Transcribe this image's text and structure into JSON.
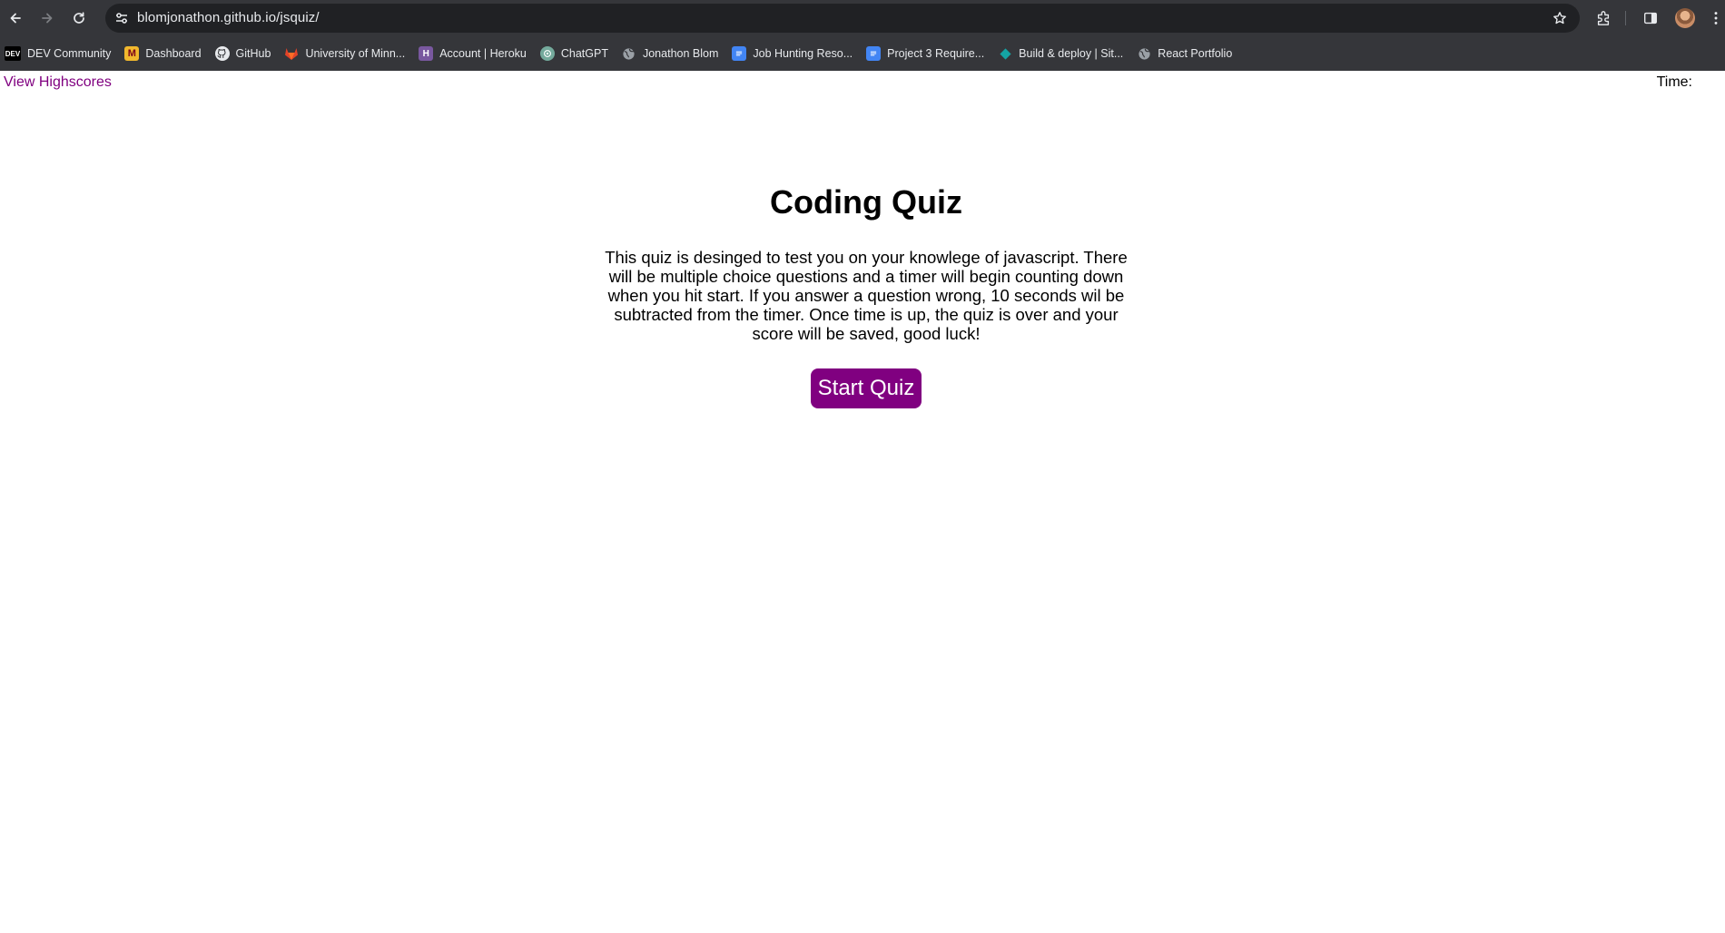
{
  "browser": {
    "url": "blomjonathon.github.io/jsquiz/",
    "bookmarks": [
      {
        "label": "DEV Community",
        "icon": "dev-icon",
        "icon_text": "DEV"
      },
      {
        "label": "Dashboard",
        "icon": "university-m-icon",
        "icon_text": "M"
      },
      {
        "label": "GitHub",
        "icon": "github-icon",
        "icon_text": ""
      },
      {
        "label": "University of Minn...",
        "icon": "gitlab-icon",
        "icon_text": ""
      },
      {
        "label": "Account | Heroku",
        "icon": "heroku-icon",
        "icon_text": "H"
      },
      {
        "label": "ChatGPT",
        "icon": "chatgpt-icon",
        "icon_text": ""
      },
      {
        "label": "Jonathon Blom",
        "icon": "globe-icon",
        "icon_text": ""
      },
      {
        "label": "Job Hunting Reso...",
        "icon": "google-docs-icon",
        "icon_text": ""
      },
      {
        "label": "Project 3 Require...",
        "icon": "google-docs-icon",
        "icon_text": ""
      },
      {
        "label": "Build & deploy | Sit...",
        "icon": "netlify-icon",
        "icon_text": ""
      },
      {
        "label": "React Portfolio",
        "icon": "globe-icon",
        "icon_text": ""
      }
    ],
    "colors": {
      "chrome": "#35363a",
      "omnibox": "#202124",
      "text": "#e8eaed"
    }
  },
  "page": {
    "highscores_link": "View Highscores",
    "timer_label": "Time:",
    "title": "Coding Quiz",
    "description": "This quiz is desinged to test you on your knowlege of javascript. There will be multiple choice questions and a timer will begin counting down when you hit start. If you answer a question wrong, 10 seconds wil be subtracted from the timer. Once time is up, the quiz is over and your score will be saved, good luck!",
    "start_button": "Start Quiz",
    "colors": {
      "accent": "#800080",
      "background": "#ffffff"
    }
  }
}
